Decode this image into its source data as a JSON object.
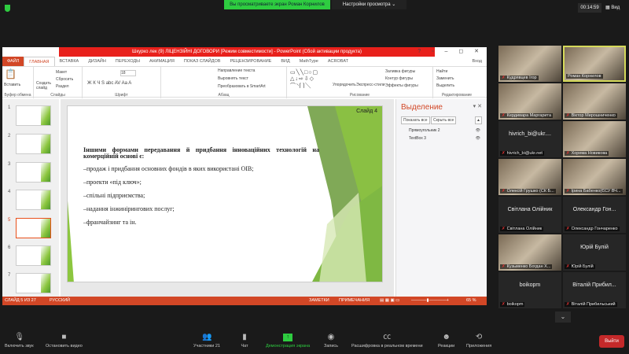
{
  "zoom": {
    "banner": "Вы просматриваете экран Роман Корнилов",
    "view_options": "Настройки просмотра ⌄",
    "timer": "00:14:59",
    "view": "Вид"
  },
  "ppt": {
    "title": "Шкурко лек (9) ЛІЦЕНЗІЙНІ ДОГОВОРИ [Режим совместимости] - PowerPoint (Сбой активации продукта)",
    "controls": "? ▫ – ◻ ✕",
    "tabs": [
      "ФАЙЛ",
      "ГЛАВНАЯ",
      "ВСТАВКА",
      "ДИЗАЙН",
      "ПЕРЕХОДЫ",
      "АНИМАЦИЯ",
      "ПОКАЗ СЛАЙДОВ",
      "РЕЦЕНЗИРОВАНИЕ",
      "ВИД",
      "MathType",
      "ACROBAT"
    ],
    "login": "Вход",
    "ribbon": {
      "clipboard": {
        "label": "Буфер обмена",
        "paste": "Вставить"
      },
      "slides": {
        "label": "Слайды",
        "new": "Создать слайд",
        "layout": "Макет",
        "reset": "Сбросить",
        "section": "Раздел"
      },
      "font": {
        "label": "Шрифт",
        "size": "18",
        "styles": "Ж К Ч S abc AV Aa A"
      },
      "paragraph": {
        "label": "Абзац",
        "direction": "Направление текста",
        "align": "Выровнять текст",
        "smartart": "Преобразовать в SmartArt"
      },
      "drawing": {
        "label": "Рисование",
        "arrange": "Упорядочить",
        "quick_styles": "Экспресс-стили",
        "fill": "Заливка фигуры",
        "outline": "Контур фигуры",
        "effects": "Эффекты фигуры"
      },
      "editing": {
        "label": "Редактирование",
        "find": "Найти",
        "replace": "Заменить",
        "select": "Выделить"
      }
    },
    "slide_numbers": [
      "1",
      "2",
      "3",
      "4",
      "5",
      "6",
      "7"
    ],
    "slide": {
      "label": "Слайд 4",
      "heading": "Іншими формами передавання й придбання інноваційних технологій на комерційній основі є:",
      "bullets": [
        "–продаж і придбання основних фондів в яких використані ОІВ;",
        "–проекти «під ключ»;",
        "–спільні підприємства;",
        "–надання інжинірингових послуг;",
        "–франчайзинг та ін."
      ]
    },
    "selection_pane": {
      "title": "Выделение",
      "show_all": "Показать все",
      "hide_all": "Скрыть все",
      "items": [
        "Прямоугольник 2",
        "TextBox 3"
      ]
    },
    "status": {
      "slide": "СЛАЙД 5 ИЗ 27",
      "lang": "РУССКИЙ",
      "notes": "ЗАМЕТКИ",
      "comments": "ПРИМЕЧАНИЯ",
      "zoom": "65 %"
    }
  },
  "participants": [
    {
      "name": "Кудрявцев Ігор",
      "video": true
    },
    {
      "name": "Роман Корнилов",
      "video": true,
      "speaking": true
    },
    {
      "name": "Кердивара Маргарита",
      "video": true
    },
    {
      "name": "Віктор Мирошниченко",
      "video": true
    },
    {
      "name": "hivrich_bi@ukr.net",
      "display": "hivrich_bi@ukr...."
    },
    {
      "name": "Хорема Новикова",
      "video": true
    },
    {
      "name": "Олексій Грушко (СК Б...",
      "video": true
    },
    {
      "name": "Ірина Бабенко(ЄСУ ВЧ...",
      "video": true
    },
    {
      "name": "Світлана Олійник",
      "display": "Світлана Олійник"
    },
    {
      "name": "Олександр Гончаренко",
      "display": "Олександр Гон..."
    },
    {
      "name": "Кузьменко Богдан Х...",
      "video": true
    },
    {
      "name": "Юрій Булій",
      "display": "Юрій Булій"
    },
    {
      "name": "boikopm",
      "display": "boikopm"
    },
    {
      "name": "Віталій Прибильський",
      "display": "Віталій Прибил..."
    }
  ],
  "toolbar": {
    "mute": "Включить звук",
    "video": "Остановить видео",
    "participants": "Участники",
    "participants_count": "21",
    "chat": "Чат",
    "share": "Демонстрация экрана",
    "record": "Запись",
    "captions": "Расшифровка в реальном времени",
    "reactions": "Реакции",
    "apps": "Приложения",
    "leave": "Выйти"
  }
}
